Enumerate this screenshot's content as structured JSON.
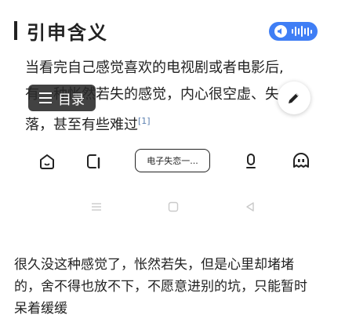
{
  "article": {
    "section_title": "引申含义",
    "para1_lines": [
      "当看完自己感觉喜欢的电视剧或者电影后,",
      "有一种怅然若失的感觉，内心很空虚、失",
      "落，甚至有些难过"
    ],
    "para1_citation": "[1]",
    "para2_lines": [
      "很久没这种感觉了，怅然若失，但是心里却堵堵",
      "的，舍不得也放不下，不愿意进别的坑，只能暂时",
      "呆着缓缓"
    ]
  },
  "toc_button": {
    "label": "目录"
  },
  "nav_bar": {
    "search_pill": "电子失恋一..."
  },
  "colors": {
    "accent": "#3f7ef5",
    "toc_bg": "#2a2a2a"
  }
}
